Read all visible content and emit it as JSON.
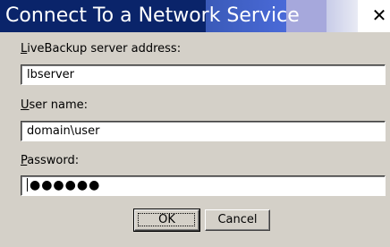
{
  "window": {
    "title": "Connect To a Network Service",
    "close_glyph": "✕"
  },
  "form": {
    "server": {
      "label_accel": "L",
      "label_rest": "iveBackup server address:",
      "value": "lbserver"
    },
    "username": {
      "label_accel": "U",
      "label_rest": "ser name:",
      "value": "domain\\user"
    },
    "password": {
      "label_accel": "P",
      "label_rest": "assword:",
      "masked_value": "●●●●●●"
    }
  },
  "buttons": {
    "ok_label": "OK",
    "cancel_label": "Cancel"
  },
  "icons": {
    "close": "close-icon"
  }
}
